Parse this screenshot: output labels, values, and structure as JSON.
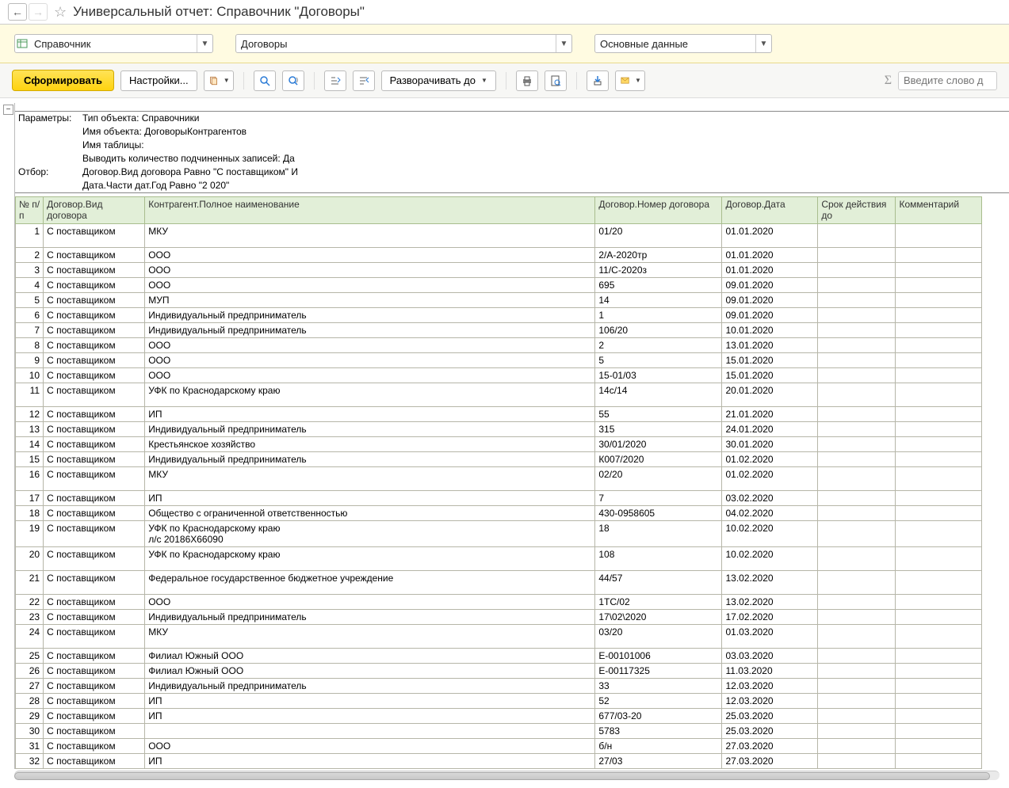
{
  "header": {
    "title": "Универсальный отчет: Справочник \"Договоры\""
  },
  "selectors": {
    "s1": "Справочник",
    "s2": "Договоры",
    "s3": "Основные данные"
  },
  "toolbar": {
    "generate": "Сформировать",
    "settings": "Настройки...",
    "expand_to": "Разворачивать до",
    "search_placeholder": "Введите слово д"
  },
  "params": {
    "label_params": "Параметры:",
    "label_filter": "Отбор:",
    "lines": {
      "l1": "Тип объекта: Справочники",
      "l2": "Имя объекта: ДоговорыКонтрагентов",
      "l3": "Имя таблицы:",
      "l4": "Выводить количество подчиненных записей: Да",
      "l5": "Договор.Вид договора Равно \"С поставщиком\" И",
      "l6": "Дата.Части дат.Год Равно \"2 020\""
    }
  },
  "columns": {
    "num": "№ п/п",
    "type": "Договор.Вид договора",
    "name": "Контрагент.Полное наименование",
    "contract": "Договор.Номер договора",
    "date": "Договор.Дата",
    "validity": "Срок действия до",
    "comment": "Комментарий"
  },
  "rows": [
    {
      "n": "1",
      "type": "С поставщиком",
      "name": "МКУ",
      "num": "01/20",
      "date": "01.01.2020",
      "tall": true
    },
    {
      "n": "2",
      "type": "С поставщиком",
      "name": "ООО",
      "num": "2/А-2020тр",
      "date": "01.01.2020"
    },
    {
      "n": "3",
      "type": "С поставщиком",
      "name": "ООО",
      "num": "11/С-2020з",
      "date": "01.01.2020"
    },
    {
      "n": "4",
      "type": "С поставщиком",
      "name": "ООО",
      "num": "695",
      "date": "09.01.2020"
    },
    {
      "n": "5",
      "type": "С поставщиком",
      "name": "МУП",
      "num": "14",
      "date": "09.01.2020"
    },
    {
      "n": "6",
      "type": "С поставщиком",
      "name": "Индивидуальный предприниматель",
      "num": "1",
      "date": "09.01.2020"
    },
    {
      "n": "7",
      "type": "С поставщиком",
      "name": "Индивидуальный предприниматель",
      "num": "106/20",
      "date": "10.01.2020"
    },
    {
      "n": "8",
      "type": "С поставщиком",
      "name": "ООО",
      "num": "2",
      "date": "13.01.2020"
    },
    {
      "n": "9",
      "type": "С поставщиком",
      "name": "ООО",
      "num": "5",
      "date": "15.01.2020"
    },
    {
      "n": "10",
      "type": "С поставщиком",
      "name": "ООО",
      "num": "15-01/03",
      "date": "15.01.2020"
    },
    {
      "n": "11",
      "type": "С поставщиком",
      "name": "УФК по Краснодарскому краю",
      "num": "14с/14",
      "date": "20.01.2020",
      "tall": true
    },
    {
      "n": "12",
      "type": "С поставщиком",
      "name": "ИП",
      "num": "55",
      "date": "21.01.2020"
    },
    {
      "n": "13",
      "type": "С поставщиком",
      "name": "Индивидуальный предприниматель",
      "num": "315",
      "date": "24.01.2020"
    },
    {
      "n": "14",
      "type": "С поставщиком",
      "name": "Крестьянское хозяйство",
      "num": "30/01/2020",
      "date": "30.01.2020"
    },
    {
      "n": "15",
      "type": "С поставщиком",
      "name": "Индивидуальный предприниматель",
      "num": "К007/2020",
      "date": "01.02.2020"
    },
    {
      "n": "16",
      "type": "С поставщиком",
      "name": "МКУ",
      "num": "02/20",
      "date": "01.02.2020",
      "tall": true
    },
    {
      "n": "17",
      "type": "С поставщиком",
      "name": "ИП",
      "num": "7",
      "date": "03.02.2020"
    },
    {
      "n": "18",
      "type": "С поставщиком",
      "name": "Общество с ограниченной ответственностью",
      "num": "430-0958605",
      "date": "04.02.2020"
    },
    {
      "n": "19",
      "type": "С поставщиком",
      "name": "УФК по Краснодарскому краю\nл/с 20186Х66090",
      "num": "18",
      "date": "10.02.2020",
      "tall": true
    },
    {
      "n": "20",
      "type": "С поставщиком",
      "name": "УФК по Краснодарскому краю",
      "num": "108",
      "date": "10.02.2020",
      "tall": true
    },
    {
      "n": "21",
      "type": "С поставщиком",
      "name": "Федеральное государственное бюджетное учреждение",
      "num": "44/57",
      "date": "13.02.2020",
      "tall": true
    },
    {
      "n": "22",
      "type": "С поставщиком",
      "name": "ООО",
      "num": "1ТС/02",
      "date": "13.02.2020"
    },
    {
      "n": "23",
      "type": "С поставщиком",
      "name": "Индивидуальный предприниматель",
      "num": "17\\02\\2020",
      "date": "17.02.2020"
    },
    {
      "n": "24",
      "type": "С поставщиком",
      "name": "МКУ",
      "num": "03/20",
      "date": "01.03.2020",
      "tall": true
    },
    {
      "n": "25",
      "type": "С поставщиком",
      "name": "Филиал Южный ООО",
      "num": "Е-00101006",
      "date": "03.03.2020"
    },
    {
      "n": "26",
      "type": "С поставщиком",
      "name": "Филиал Южный ООО",
      "num": "Е-00117325",
      "date": "11.03.2020"
    },
    {
      "n": "27",
      "type": "С поставщиком",
      "name": "Индивидуальный предприниматель",
      "num": "33",
      "date": "12.03.2020"
    },
    {
      "n": "28",
      "type": "С поставщиком",
      "name": "ИП",
      "num": "52",
      "date": "12.03.2020"
    },
    {
      "n": "29",
      "type": "С поставщиком",
      "name": "ИП",
      "num": "677/03-20",
      "date": "25.03.2020"
    },
    {
      "n": "30",
      "type": "С поставщиком",
      "name": "",
      "num": "5783",
      "date": "25.03.2020"
    },
    {
      "n": "31",
      "type": "С поставщиком",
      "name": "ООО",
      "num": "б/н",
      "date": "27.03.2020"
    },
    {
      "n": "32",
      "type": "С поставщиком",
      "name": "ИП",
      "num": "27/03",
      "date": "27.03.2020"
    }
  ]
}
